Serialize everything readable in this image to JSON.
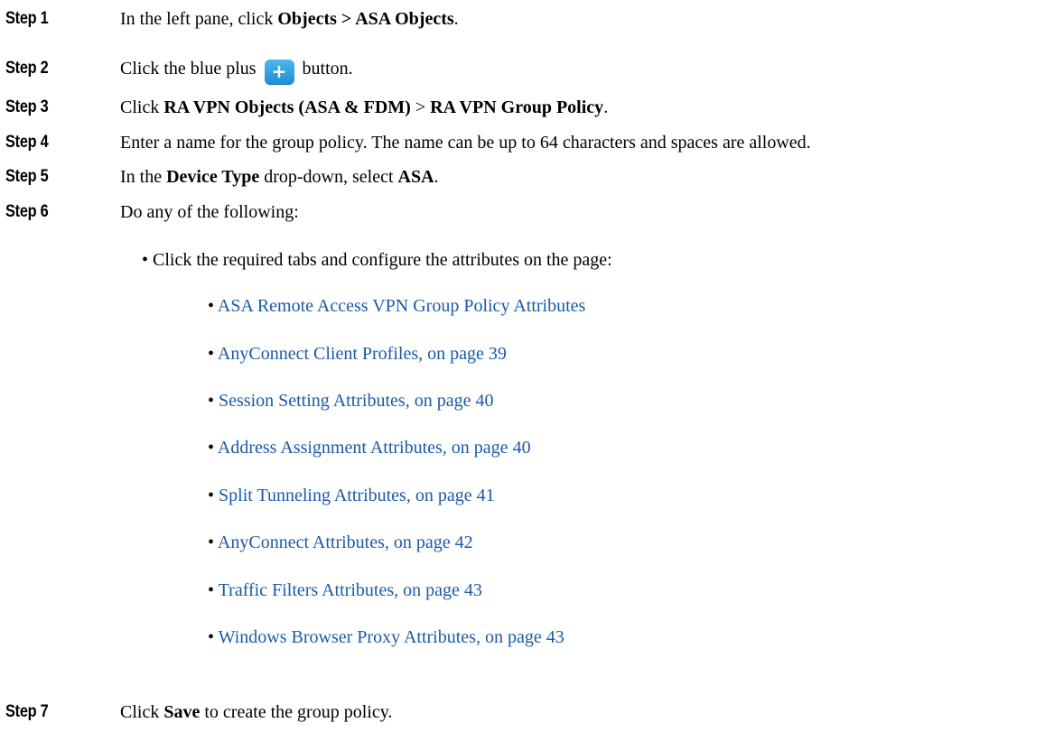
{
  "steps": [
    {
      "label": "Step 1",
      "parts": [
        "In the left pane, click ",
        "Objects > ASA Objects",
        "."
      ]
    },
    {
      "label": "Step 2",
      "before": "Click the blue plus",
      "button_glyph": "+",
      "button_icon": "plus-icon",
      "after": "button."
    },
    {
      "label": "Step 3",
      "parts": [
        "Click ",
        "RA VPN Objects (ASA & FDM)",
        " > ",
        "RA VPN Group Policy",
        "."
      ]
    },
    {
      "label": "Step 4",
      "text": "Enter a name for the group policy. The name can be up to 64 characters and spaces are allowed."
    },
    {
      "label": "Step 5",
      "parts": [
        "In the ",
        "Device Type",
        " drop-down, select ",
        "ASA",
        "."
      ]
    },
    {
      "label": "Step 6",
      "text": "Do any of the following:"
    },
    {
      "label": "Step 7",
      "parts": [
        "Click ",
        "Save",
        " to create the group policy."
      ]
    }
  ],
  "bullet": {
    "marker": "•",
    "text": "Click the required tabs and configure the attributes on the page:"
  },
  "links": [
    "ASA Remote Access VPN Group Policy Attributes",
    "AnyConnect Client Profiles, on page 39",
    "Session Setting Attributes, on page 40",
    "Address Assignment Attributes, on page 40",
    "Split Tunneling Attributes, on page 41",
    "AnyConnect Attributes, on page 42",
    "Traffic Filters Attributes, on page 43",
    "Windows Browser Proxy Attributes, on page 43"
  ],
  "colors": {
    "link": "#1a5aa8",
    "plus_button": "#2a9ee0"
  }
}
